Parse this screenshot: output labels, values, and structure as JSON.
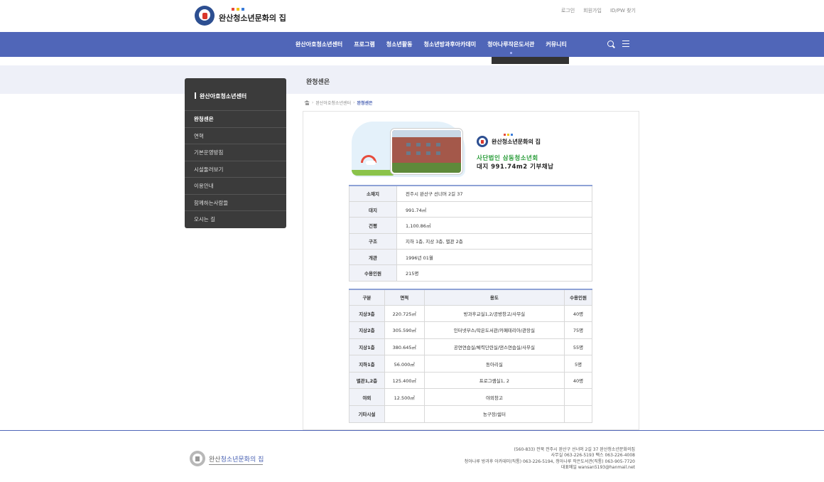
{
  "header": {
    "logo_text": "완산청소년문화의 집",
    "logo_dot_colors": [
      "#e74c3c",
      "#f1c40f",
      "#3b7dd8"
    ],
    "util_links": [
      "로그인",
      "회원가입",
      "ID/PW 찾기"
    ]
  },
  "nav": {
    "items": [
      "완산아호청소년센터",
      "프로그램",
      "청소년활동",
      "청소년방과후아카데미",
      "청아나루작은도서관",
      "커뮤니티"
    ],
    "active_index": 4,
    "accent_color": "#5066b8"
  },
  "page": {
    "title": "완청센은"
  },
  "sidebar": {
    "heading": "완산아호청소년센터",
    "items": [
      "완청센은",
      "연혁",
      "기본운영방침",
      "시설둘러보기",
      "이용안내",
      "함께하는사람들",
      "오시는 길"
    ],
    "active_index": 0
  },
  "breadcrumb": {
    "parent": "완산아호청소년센터",
    "current": "완청센은"
  },
  "hero": {
    "logo_text": "완산청소년문화의 집",
    "org": "사단법인 삼동청소년회",
    "note": "대지 991.74m2 기부채납"
  },
  "info": {
    "rows": [
      {
        "label": "소재지",
        "value": "전주시 완산구 선너머 2길 37"
      },
      {
        "label": "대지",
        "value": "991.74㎡"
      },
      {
        "label": "건평",
        "value": "1,100.86㎡"
      },
      {
        "label": "구조",
        "value": "지하 1층, 지상 3층, 별관 2층"
      },
      {
        "label": "개관",
        "value": "1996년 01월"
      },
      {
        "label": "수용인원",
        "value": "215명"
      }
    ]
  },
  "spec": {
    "headers": [
      "구분",
      "면적",
      "용도",
      "수용인원"
    ],
    "rows": [
      {
        "floor": "지상3층",
        "area": "220.725㎡",
        "use": "방과후교실1,2/공방창고/사무실",
        "cap": "40명"
      },
      {
        "floor": "지상2층",
        "area": "305.590㎡",
        "use": "인터넷부스/작은도서관/카페테리아/관장실",
        "cap": "75명"
      },
      {
        "floor": "지상1층",
        "area": "380.645㎡",
        "use": "공연연습실/체력단련실/댄스연습실/사무실",
        "cap": "55명"
      },
      {
        "floor": "지하1층",
        "area": "56.000㎡",
        "use": "동아리실",
        "cap": "5명"
      },
      {
        "floor": "별관1,2층",
        "area": "125.400㎡",
        "use": "프로그램실1, 2",
        "cap": "40명"
      },
      {
        "floor": "야외",
        "area": "12.500㎡",
        "use": "야외창고",
        "cap": ""
      },
      {
        "floor": "기타시설",
        "area": "",
        "use": "농구장/쉼터",
        "cap": ""
      }
    ]
  },
  "footer": {
    "logo_main": "완산",
    "logo_accent": "청소년문화의 집",
    "lines": [
      "(560-833) 전북 전주시 완산구 선너머 2길 37 완산청소년문화의집",
      "사무실 063-226-5193 팩스 063-226-4008",
      "청아나루 방과후 아카데미(직통) 063-226-5194, 청아나루 작은도서관(직통) 063-905-7720",
      "대표메일 wansan5193@hanmail.net"
    ]
  }
}
